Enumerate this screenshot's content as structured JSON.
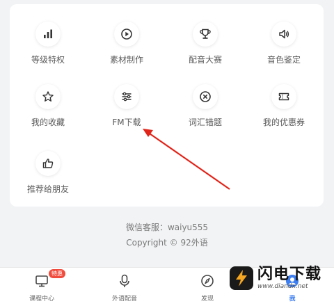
{
  "grid": [
    {
      "label": "等级特权",
      "icon": "bar-chart-icon"
    },
    {
      "label": "素材制作",
      "icon": "play-circle-icon"
    },
    {
      "label": "配音大赛",
      "icon": "trophy-icon"
    },
    {
      "label": "音色鉴定",
      "icon": "speaker-icon"
    },
    {
      "label": "我的收藏",
      "icon": "star-icon"
    },
    {
      "label": "FM下载",
      "icon": "sliders-icon"
    },
    {
      "label": "词汇错题",
      "icon": "close-circle-icon"
    },
    {
      "label": "我的优惠券",
      "icon": "ticket-icon"
    },
    {
      "label": "推荐给朋友",
      "icon": "thumbs-up-icon"
    }
  ],
  "footer": {
    "service": "微信客服：waiyu555",
    "copyright": "Copyright © 92外语"
  },
  "tabbar": {
    "tabs": [
      {
        "label": "课程中心",
        "icon": "monitor-icon",
        "badge": "特惠"
      },
      {
        "label": "外语配音",
        "icon": "microphone-icon"
      },
      {
        "label": "发现",
        "icon": "compass-icon"
      },
      {
        "label": "我",
        "icon": "person-icon",
        "active": true
      }
    ]
  },
  "watermark": {
    "title": "闪电下载",
    "url": "www.diandx.net"
  },
  "colors": {
    "accent": "#3d7ef0",
    "annotation_arrow": "#e0251b",
    "badge": "#f04b3c"
  }
}
